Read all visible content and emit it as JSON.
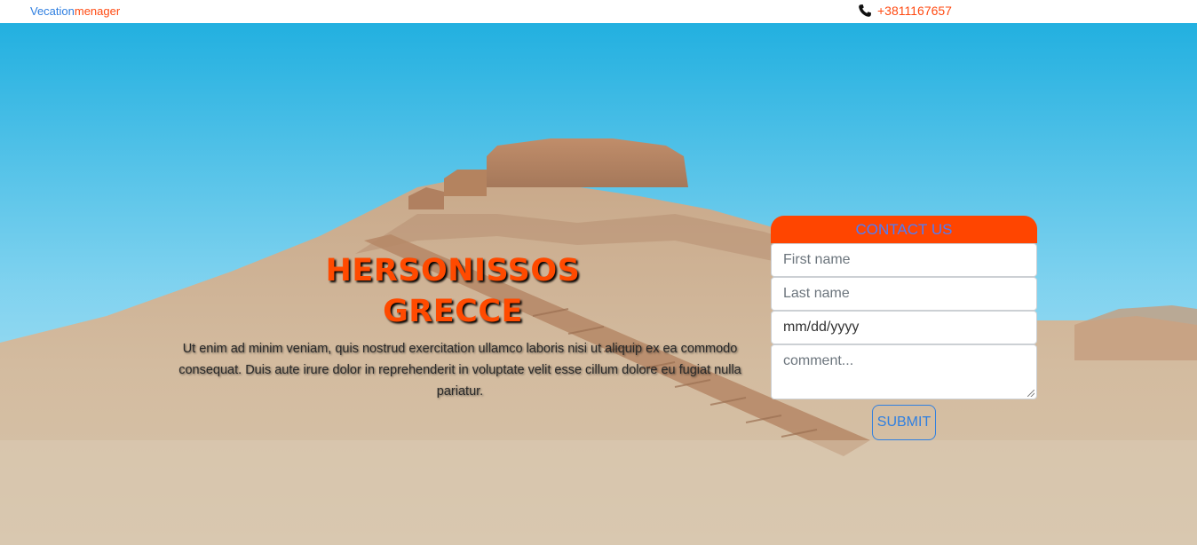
{
  "nav": {
    "brand_part1": "Vecation",
    "brand_part2": "menager",
    "phone_icon": "phone-icon",
    "phone_number": "+3811167657"
  },
  "hero": {
    "title_line1": "HERSONISSOS",
    "title_line2": "GRECCE",
    "description": "Ut enim ad minim veniam, quis nostrud exercitation ullamco laboris nisi ut aliquip ex ea commodo consequat. Duis aute irure dolor in reprehenderit in voluptate velit esse cillum dolore eu fugiat nulla pariatur."
  },
  "contact_form": {
    "header": "CONTACT US",
    "first_name_placeholder": "First name",
    "last_name_placeholder": "Last name",
    "date_placeholder": "mm/dd/yyyy",
    "comment_placeholder": "comment...",
    "submit_label": "SUBMIT"
  },
  "colors": {
    "accent": "#ff4500",
    "link_blue": "#2f7fe0"
  }
}
